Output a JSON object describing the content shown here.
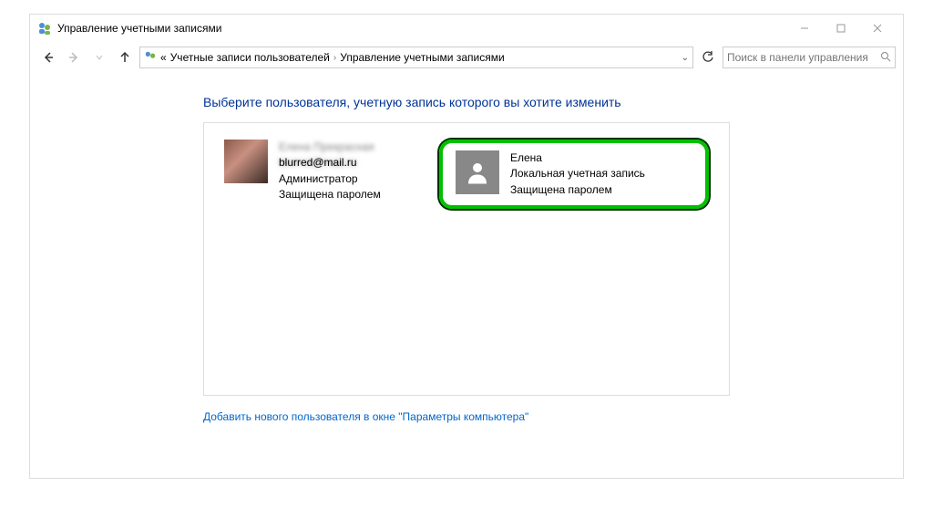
{
  "window": {
    "title": "Управление учетными записями"
  },
  "breadcrumb": {
    "prefix": "«",
    "item1": "Учетные записи пользователей",
    "item2": "Управление учетными записями"
  },
  "search": {
    "placeholder": "Поиск в панели управления"
  },
  "content": {
    "heading": "Выберите пользователя, учетную запись которого вы хотите изменить",
    "add_link": "Добавить нового пользователя в окне \"Параметры компьютера\""
  },
  "users": [
    {
      "name": "Елена Прекрасная",
      "email": "blurred@mail.ru",
      "role": "Администратор",
      "protected": "Защищена паролем"
    },
    {
      "name": "Елена",
      "role": "Локальная учетная запись",
      "protected": "Защищена паролем"
    }
  ]
}
